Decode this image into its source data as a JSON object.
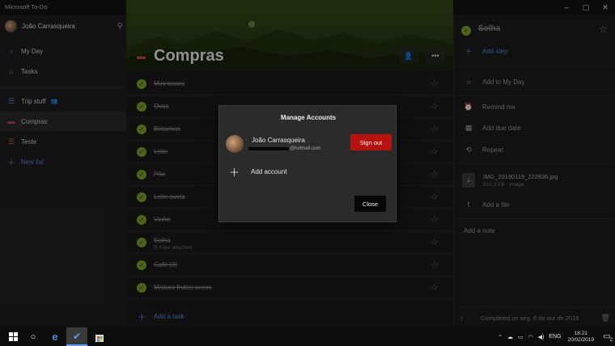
{
  "app": {
    "title": "Microsoft To-Do"
  },
  "window_controls": {
    "minimize": "–",
    "maximize": "▢",
    "close": "✕"
  },
  "sidebar": {
    "user_name": "João Carrasqueira",
    "items": [
      {
        "label": "My Day",
        "icon": "sun-icon"
      },
      {
        "label": "Tasks",
        "icon": "home-icon"
      },
      {
        "label": "Trip stuff",
        "icon": "list-icon",
        "shared": true
      },
      {
        "label": "Compras",
        "icon": "car-icon"
      },
      {
        "label": "Teste",
        "icon": "list-icon"
      }
    ],
    "new_list_label": "New list"
  },
  "list": {
    "title": "Compras",
    "tasks": [
      {
        "name": "Mini tostas",
        "sub": ""
      },
      {
        "name": "Ovos",
        "sub": ""
      },
      {
        "name": "Bolachas",
        "sub": ""
      },
      {
        "name": "Leite",
        "sub": ""
      },
      {
        "name": "Pão",
        "sub": ""
      },
      {
        "name": "Leite aveia",
        "sub": ""
      },
      {
        "name": "Vinho",
        "sub": ""
      },
      {
        "name": "Solha",
        "sub": "Files attached"
      },
      {
        "name": "Café (3)",
        "sub": ""
      },
      {
        "name": "Mistura frutos secos",
        "sub": ""
      }
    ],
    "add_task_label": "Add a task"
  },
  "detail": {
    "task_title": "Solha",
    "add_step": "Add step",
    "add_to_my_day": "Add to My Day",
    "remind_me": "Remind me",
    "add_due_date": "Add due date",
    "repeat": "Repeat",
    "file_name": "IMG_20190119_222836.jpg",
    "file_meta": "312.3 KB · Image",
    "add_file": "Add a file",
    "add_note": "Add a note",
    "completed_text": "Completed on seg, 8 de out de 2018"
  },
  "modal": {
    "title": "Manage Accounts",
    "account_name": "João Carrasqueira",
    "email_suffix": "@hotmail.com",
    "sign_out_label": "Sign out",
    "add_account_label": "Add account",
    "close_label": "Close"
  },
  "taskbar": {
    "language": "ENG",
    "time": "18:21",
    "date": "20/02/2019",
    "notification_count": "2"
  },
  "colors": {
    "accent_green": "#7aa22b",
    "accent_blue": "#4d8ae0",
    "sign_out_red": "#b8120e"
  }
}
